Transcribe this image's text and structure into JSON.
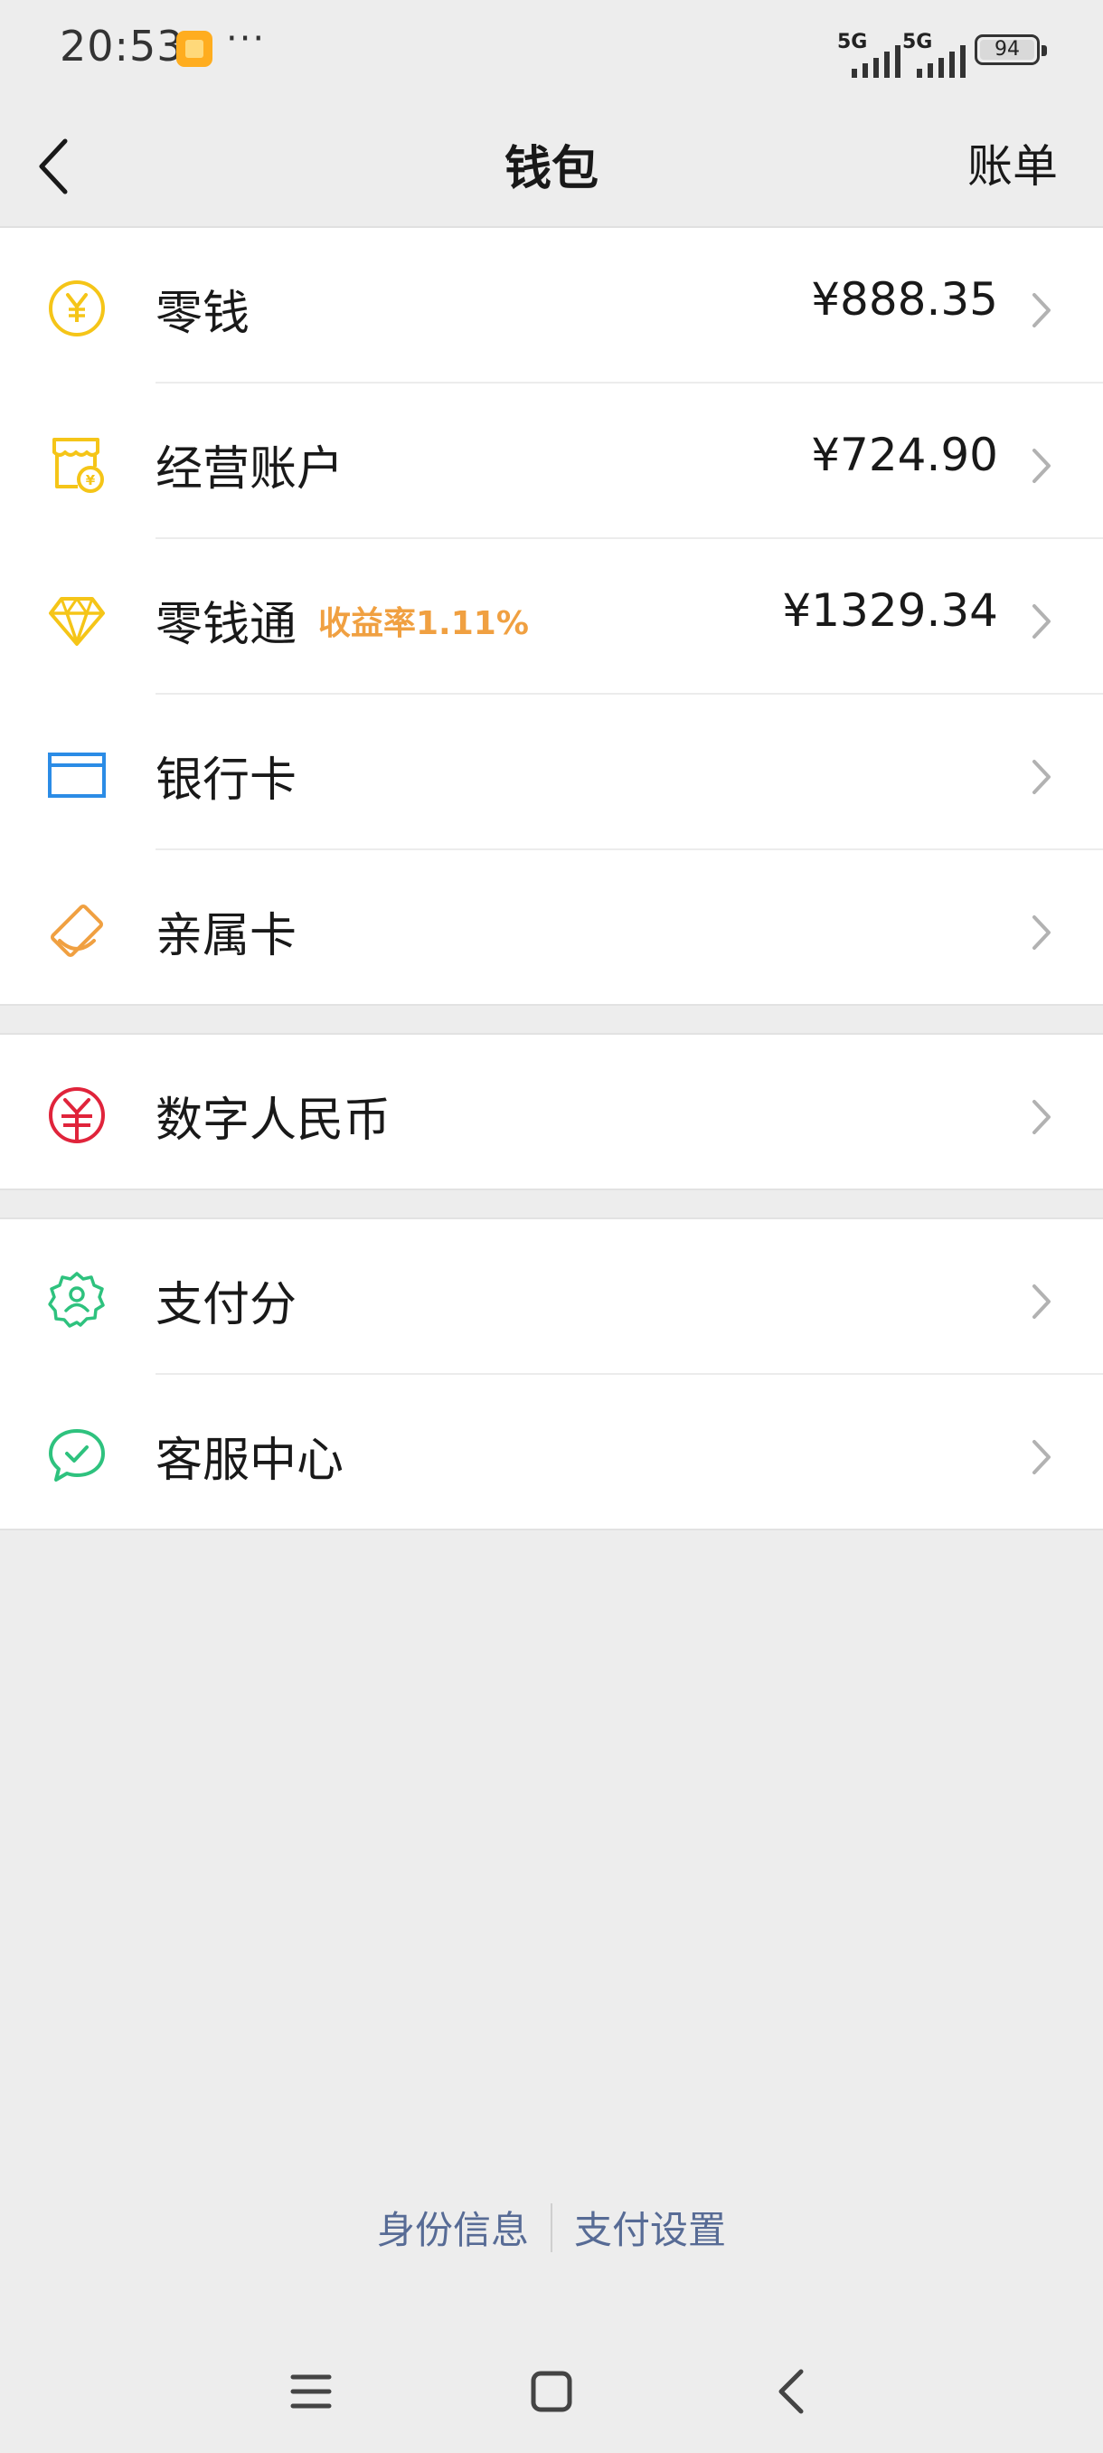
{
  "status_bar": {
    "time": "20:53",
    "dots": "···",
    "network_1": "5G",
    "network_2": "5G",
    "battery": "94"
  },
  "nav": {
    "title": "钱包",
    "action": "账单",
    "back_icon": "chevron-left-icon"
  },
  "wallet_items": [
    {
      "label": "零钱",
      "amount": "¥888.35",
      "icon": "coin-yen-icon",
      "color": "#f5c518"
    },
    {
      "label": "经营账户",
      "amount": "¥724.90",
      "icon": "shop-icon",
      "color": "#f5c518"
    },
    {
      "label": "零钱通",
      "tag": "收益率1.11%",
      "amount": "¥1329.34",
      "icon": "diamond-icon",
      "color": "#f5c518"
    },
    {
      "label": "银行卡",
      "icon": "bank-card-icon",
      "color": "#2b8ce6"
    },
    {
      "label": "亲属卡",
      "icon": "family-card-icon",
      "color": "#f0a041"
    }
  ],
  "digital_currency": {
    "label": "数字人民币",
    "icon": "digital-rmb-icon",
    "color": "#e0243b"
  },
  "services": [
    {
      "label": "支付分",
      "icon": "badge-user-icon",
      "color": "#2ec27e"
    },
    {
      "label": "客服中心",
      "icon": "chat-check-icon",
      "color": "#2ec27e"
    }
  ],
  "footer": {
    "identity": "身份信息",
    "pay_settings": "支付设置",
    "link_color": "#576b95"
  },
  "system_nav": [
    "menu-icon",
    "home-icon",
    "back-icon"
  ]
}
